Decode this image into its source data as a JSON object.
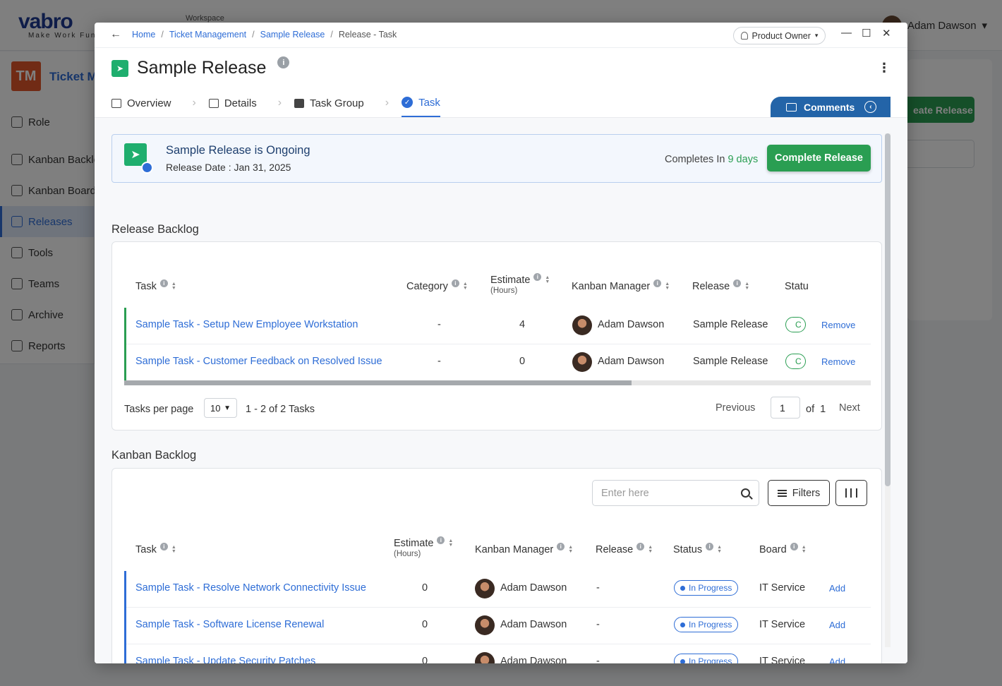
{
  "background": {
    "workspace_label": "Workspace",
    "logo_text": "vabro",
    "logo_tagline": "Make Work Fun",
    "user_name": "Adam Dawson",
    "app_initials": "TM",
    "app_title": "Ticket M",
    "nav": [
      "Role",
      "Kanban Backlog",
      "Kanban Board",
      "Releases",
      "Tools",
      "Teams",
      "Archive",
      "Reports"
    ],
    "create_button": "eate Release"
  },
  "modal": {
    "breadcrumbs": [
      "Home",
      "Ticket Management",
      "Sample Release",
      "Release - Task"
    ],
    "role": "Product Owner",
    "title": "Sample Release",
    "tabs": [
      {
        "label": "Overview",
        "icon": "table-icon"
      },
      {
        "label": "Details",
        "icon": "list-icon"
      },
      {
        "label": "Task Group",
        "icon": "briefcase-icon"
      },
      {
        "label": "Task",
        "icon": "check-circle-icon"
      }
    ],
    "comments_label": "Comments"
  },
  "banner": {
    "title": "Sample Release is Ongoing",
    "release_date": "Release Date : Jan 31, 2025",
    "completes_prefix": "Completes In",
    "completes_days": "9 days",
    "button": "Complete Release"
  },
  "release_backlog": {
    "title": "Release Backlog",
    "columns": [
      "Task",
      "Category",
      "Estimate",
      "Kanban Manager",
      "Release",
      "Statu"
    ],
    "estimate_sub": "(Hours)",
    "rows": [
      {
        "task": "Sample Task - Setup New Employee Workstation",
        "category": "-",
        "estimate": "4",
        "manager": "Adam Dawson",
        "release": "Sample Release",
        "status": "C",
        "action": "Remove"
      },
      {
        "task": "Sample Task - Customer Feedback on Resolved Issue",
        "category": "-",
        "estimate": "0",
        "manager": "Adam Dawson",
        "release": "Sample Release",
        "status": "C",
        "action": "Remove"
      }
    ],
    "per_page_label": "Tasks per page",
    "per_page": "10",
    "range": "1 - 2 of 2 Tasks",
    "previous": "Previous",
    "page": "1",
    "of_label": "of",
    "total_pages": "1",
    "next": "Next",
    "scroll_fraction": 0.68
  },
  "kanban_backlog": {
    "title": "Kanban Backlog",
    "search_placeholder": "Enter here",
    "filters_label": "Filters",
    "columns": [
      "Task",
      "Estimate",
      "Kanban Manager",
      "Release",
      "Status",
      "Board"
    ],
    "estimate_sub": "(Hours)",
    "rows": [
      {
        "task": "Sample Task - Resolve Network Connectivity Issue",
        "estimate": "0",
        "manager": "Adam Dawson",
        "release": "-",
        "status": "In Progress",
        "board": "IT Service",
        "action": "Add"
      },
      {
        "task": "Sample Task - Software License Renewal",
        "estimate": "0",
        "manager": "Adam Dawson",
        "release": "-",
        "status": "In Progress",
        "board": "IT Service",
        "action": "Add"
      },
      {
        "task": "Sample Task - Update Security Patches",
        "estimate": "0",
        "manager": "Adam Dawson",
        "release": "-",
        "status": "In Progress",
        "board": "IT Service",
        "action": "Add"
      }
    ]
  },
  "colors": {
    "accent_blue": "#2e6dd6",
    "brand_green": "#2a9e52",
    "release_row_bar": "#2a9e52",
    "kanban_row_bar": "#2e6dd6"
  }
}
